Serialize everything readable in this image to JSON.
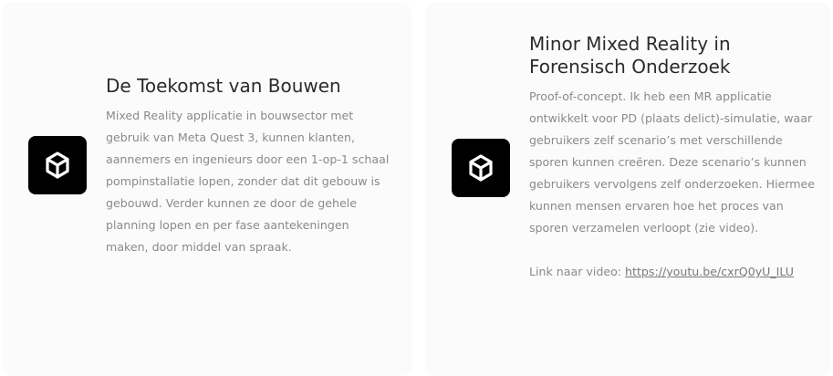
{
  "cards": [
    {
      "logo_icon": "unity-logo-icon",
      "title": "De Toekomst van Bouwen",
      "description": "Mixed Reality applicatie in bouwsector met gebruik van Meta Quest 3, kunnen klanten, aannemers en ingenieurs door een 1-op-1 schaal pompinstallatie lopen, zonder dat dit gebouw is gebouwd. Verder kunnen ze door de gehele planning lopen en per fase aantekeningen maken, door middel van spraak."
    },
    {
      "logo_icon": "unity-logo-icon",
      "title": "Minor Mixed Reality in Forensisch Onderzoek",
      "description": "Proof-of-concept. Ik heb een MR applicatie ontwikkelt voor PD (plaats delict)-simulatie, waar gebruikers zelf scenario’s met verschillende sporen kunnen creëren. Deze scenario’s kunnen gebruikers vervolgens zelf onderzoeken. Hiermee kunnen mensen ervaren hoe het proces van sporen verzamelen verloopt (zie video).",
      "link_prefix": "Link naar video: ",
      "link_text": "https://youtu.be/cxrQ0yU_ILU"
    }
  ],
  "colors": {
    "card_bg": "#fbfbfb",
    "logo_bg": "#000000",
    "title": "#2b2b2b",
    "body": "#8a8a8a"
  }
}
